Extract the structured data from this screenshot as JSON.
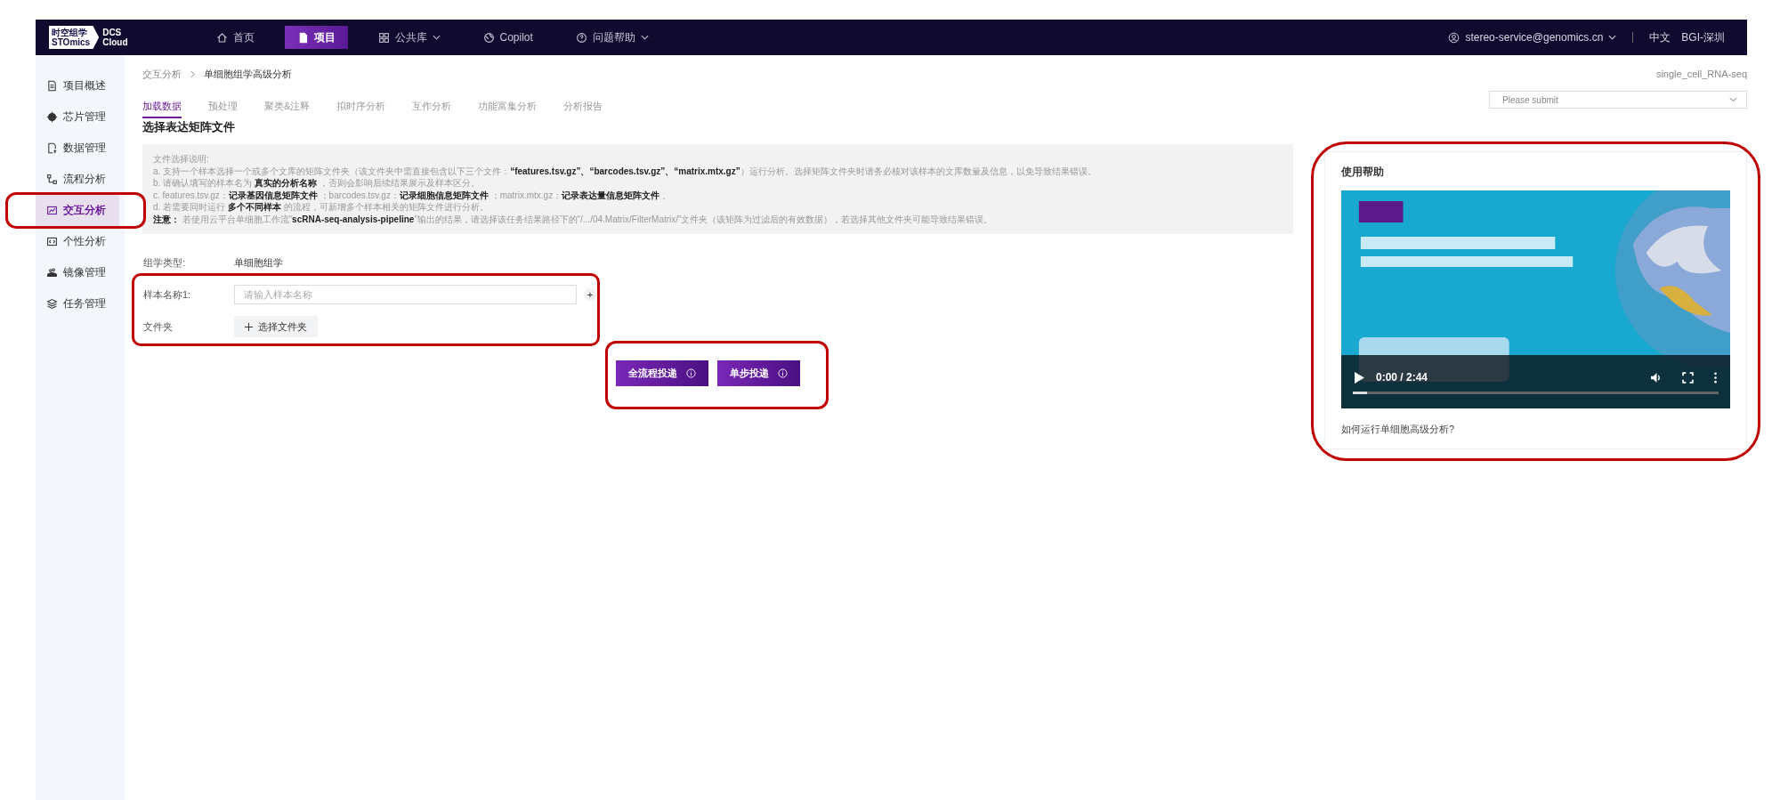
{
  "header": {
    "logo": {
      "line1": "时空组学",
      "line2": "STOmics",
      "product1": "DCS",
      "product2": "Cloud"
    },
    "nav": [
      {
        "label": "首页",
        "selected": false,
        "dropdown": false
      },
      {
        "label": "项目",
        "selected": true,
        "dropdown": false
      },
      {
        "label": "公共库",
        "selected": false,
        "dropdown": true
      },
      {
        "label": "Copilot",
        "selected": false,
        "dropdown": false
      },
      {
        "label": "问题帮助",
        "selected": false,
        "dropdown": true
      }
    ],
    "user": "stereo-service@genomics.cn",
    "language": "中文",
    "region": "BGI-深圳"
  },
  "sidebar": {
    "items": [
      {
        "label": "项目概述",
        "selected": false,
        "highlighted": false
      },
      {
        "label": "芯片管理",
        "selected": false,
        "highlighted": false
      },
      {
        "label": "数据管理",
        "selected": false,
        "highlighted": false
      },
      {
        "label": "流程分析",
        "selected": false,
        "highlighted": false
      },
      {
        "label": "交互分析",
        "selected": true,
        "highlighted": true
      },
      {
        "label": "个性分析",
        "selected": false,
        "highlighted": false
      },
      {
        "label": "镜像管理",
        "selected": false,
        "highlighted": false
      },
      {
        "label": "任务管理",
        "selected": false,
        "highlighted": false
      }
    ]
  },
  "breadcrumb": [
    "交互分析",
    "单细胞组学高级分析"
  ],
  "pipeline_name": "single_cell_RNA-seq",
  "tabs": [
    {
      "label": "加载数据",
      "selected": true
    },
    {
      "label": "预处理",
      "selected": false
    },
    {
      "label": "聚类&注释",
      "selected": false
    },
    {
      "label": "拟时序分析",
      "selected": false
    },
    {
      "label": "互作分析",
      "selected": false
    },
    {
      "label": "功能富集分析",
      "selected": false
    },
    {
      "label": "分析报告",
      "selected": false
    }
  ],
  "submit_select": {
    "placeholder": "Please submit"
  },
  "section_title": "选择表达矩阵文件",
  "instructions": [
    "文件选择说明:",
    "a. 支持一个样本选择一个或多个文库的矩阵文件夹（该文件夹中需直接包含以下三个文件：**“features.tsv.gz”、“barcodes.tsv.gz”、“matrix.mtx.gz”**）运行分析。选择矩阵文件夹时请务必核对该样本的文库数量及信息，以免导致结果错误。",
    "b. 请确认填写的样本名为 **真实的分析名称** ，否则会影响后续结果展示及样本区分。",
    "c. features.tsv.gz：**记录基因信息矩阵文件** ；barcodes.tsv.gz：**记录细胞信息矩阵文件** ；matrix.mtx.gz：**记录表达量信息矩阵文件** 。",
    "d. 若需要同时运行 **多个不同样本** 的流程，可新增多个样本相关的矩阵文件进行分析。",
    "**注意：** 若使用云平台单细胞工作流“**scRNA-seq-analysis-pipeline**”输出的结果，请选择该任务结果路径下的“/.../04.Matrix/FilterMatrix/”文件夹（该矩阵为过滤后的有效数据），若选择其他文件夹可能导致结果错误。"
  ],
  "form": {
    "highlighted": true,
    "omics_label": "组学类型:",
    "omics_value": "单细胞组学",
    "sample_label": "样本名称1:",
    "sample_placeholder": "请输入样本名称",
    "add": "+",
    "folder_label": "文件夹",
    "folder_button": "选择文件夹"
  },
  "actions": {
    "highlighted": true,
    "buttons": [
      "全流程投递",
      "单步投递"
    ]
  },
  "help": {
    "highlighted": true,
    "title": "使用帮助",
    "video": {
      "kind": "picture",
      "time": "0:00 / 2:44",
      "level": 0.04
    },
    "link": "如何运行单细胞高级分析?"
  }
}
